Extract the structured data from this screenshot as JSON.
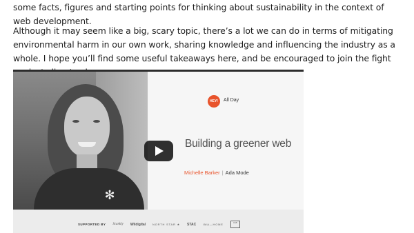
{
  "article": {
    "paragraph_1": "some facts, figures and starting points for thinking about sustainability in the context of web development.",
    "paragraph_2": "Although it may seem like a big, scary topic, there’s a lot we can do in terms of mitigating environmental harm in our own work, sharing knowledge and influencing the industry as a whole. I hope you’ll find some useful takeaways here, and be encouraged to join the fight against climate change."
  },
  "video": {
    "event_badge": "HEY!",
    "event_suffix": "All Day",
    "talk_title": "Building a greener web",
    "speaker_name": "Michelle Barker",
    "speaker_separator": "|",
    "speaker_company": "Ada Mode",
    "play_icon": "play-icon",
    "sponsor_label": "SUPPORTED BY",
    "sponsors": [
      "Scankly",
      "Wildigital",
      "NORTH STAR ★",
      "STAC",
      "IMA—HOME",
      "UoB"
    ],
    "colors": {
      "accent": "#e8532b",
      "play_button_bg": "#141414"
    }
  }
}
